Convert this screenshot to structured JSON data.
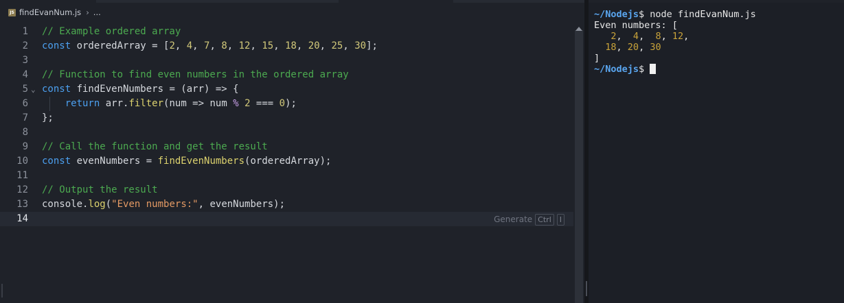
{
  "breadcrumb": {
    "file": "findEvanNum.js",
    "sep": "›",
    "more": "...",
    "badge": "JS"
  },
  "editor": {
    "lines": [
      {
        "n": "1",
        "parts": [
          {
            "t": "// Example ordered array",
            "c": "cmt"
          }
        ]
      },
      {
        "n": "2",
        "parts": [
          {
            "t": "const ",
            "c": "kw"
          },
          {
            "t": "orderedArray = [",
            "c": "plain"
          },
          {
            "t": "2",
            "c": "num"
          },
          {
            "t": ", ",
            "c": "plain"
          },
          {
            "t": "4",
            "c": "num"
          },
          {
            "t": ", ",
            "c": "plain"
          },
          {
            "t": "7",
            "c": "num"
          },
          {
            "t": ", ",
            "c": "plain"
          },
          {
            "t": "8",
            "c": "num"
          },
          {
            "t": ", ",
            "c": "plain"
          },
          {
            "t": "12",
            "c": "num"
          },
          {
            "t": ", ",
            "c": "plain"
          },
          {
            "t": "15",
            "c": "num"
          },
          {
            "t": ", ",
            "c": "plain"
          },
          {
            "t": "18",
            "c": "num"
          },
          {
            "t": ", ",
            "c": "plain"
          },
          {
            "t": "20",
            "c": "num"
          },
          {
            "t": ", ",
            "c": "plain"
          },
          {
            "t": "25",
            "c": "num"
          },
          {
            "t": ", ",
            "c": "plain"
          },
          {
            "t": "30",
            "c": "num"
          },
          {
            "t": "];",
            "c": "plain"
          }
        ]
      },
      {
        "n": "3",
        "parts": []
      },
      {
        "n": "4",
        "parts": [
          {
            "t": "// Function to find even numbers in the ordered array",
            "c": "cmt"
          }
        ]
      },
      {
        "n": "5",
        "fold": "⌄",
        "parts": [
          {
            "t": "const ",
            "c": "kw"
          },
          {
            "t": "findEvenNumbers = (arr) => {",
            "c": "plain"
          }
        ]
      },
      {
        "n": "6",
        "guide": true,
        "parts": [
          {
            "t": "    ",
            "c": "plain"
          },
          {
            "t": "return ",
            "c": "kw"
          },
          {
            "t": "arr.",
            "c": "plain"
          },
          {
            "t": "filter",
            "c": "fn"
          },
          {
            "t": "(num => num ",
            "c": "plain"
          },
          {
            "t": "%",
            "c": "op"
          },
          {
            "t": " ",
            "c": "plain"
          },
          {
            "t": "2",
            "c": "num"
          },
          {
            "t": " === ",
            "c": "plain"
          },
          {
            "t": "0",
            "c": "num"
          },
          {
            "t": ");",
            "c": "plain"
          }
        ]
      },
      {
        "n": "7",
        "parts": [
          {
            "t": "};",
            "c": "plain"
          }
        ]
      },
      {
        "n": "8",
        "parts": []
      },
      {
        "n": "9",
        "parts": [
          {
            "t": "// Call the function and get the result",
            "c": "cmt"
          }
        ]
      },
      {
        "n": "10",
        "parts": [
          {
            "t": "const ",
            "c": "kw"
          },
          {
            "t": "evenNumbers = ",
            "c": "plain"
          },
          {
            "t": "findEvenNumbers",
            "c": "fn"
          },
          {
            "t": "(orderedArray);",
            "c": "plain"
          }
        ]
      },
      {
        "n": "11",
        "parts": []
      },
      {
        "n": "12",
        "parts": [
          {
            "t": "// Output the result",
            "c": "cmt"
          }
        ]
      },
      {
        "n": "13",
        "parts": [
          {
            "t": "console.",
            "c": "plain"
          },
          {
            "t": "log",
            "c": "fn"
          },
          {
            "t": "(",
            "c": "plain"
          },
          {
            "t": "\"Even numbers:\"",
            "c": "str"
          },
          {
            "t": ", evenNumbers);",
            "c": "plain"
          }
        ]
      },
      {
        "n": "14",
        "active": true,
        "parts": []
      }
    ],
    "generate": {
      "label": "Generate",
      "key1": "Ctrl",
      "key2": "I"
    }
  },
  "terminal": {
    "lines": [
      [
        {
          "t": "~/Nodejs",
          "c": "tpath"
        },
        {
          "t": "$ node findEvanNum.js",
          "c": ""
        }
      ],
      [
        {
          "t": "Even numbers: [",
          "c": ""
        }
      ],
      [
        {
          "t": "   ",
          "c": ""
        },
        {
          "t": "2",
          "c": "tnum"
        },
        {
          "t": ",  ",
          "c": ""
        },
        {
          "t": "4",
          "c": "tnum"
        },
        {
          "t": ",  ",
          "c": ""
        },
        {
          "t": "8",
          "c": "tnum"
        },
        {
          "t": ", ",
          "c": ""
        },
        {
          "t": "12",
          "c": "tnum"
        },
        {
          "t": ",",
          "c": ""
        }
      ],
      [
        {
          "t": "  ",
          "c": ""
        },
        {
          "t": "18",
          "c": "tnum"
        },
        {
          "t": ", ",
          "c": ""
        },
        {
          "t": "20",
          "c": "tnum"
        },
        {
          "t": ", ",
          "c": ""
        },
        {
          "t": "30",
          "c": "tnum"
        }
      ],
      [
        {
          "t": "]",
          "c": ""
        }
      ],
      [
        {
          "t": "~/Nodejs",
          "c": "tpath"
        },
        {
          "t": "$ ",
          "c": ""
        }
      ]
    ]
  },
  "colors": {
    "comment": "#4caa50",
    "keyword": "#4ca0f0",
    "number": "#d2c97a",
    "function": "#dcd26e",
    "string": "#e49a64",
    "prompt": "#5aa6f0",
    "term_number": "#c9a33a"
  },
  "icons": {
    "file": "js-file-icon",
    "fold": "chevron-down-icon",
    "scroll": "scroll-up-arrow-icon"
  }
}
